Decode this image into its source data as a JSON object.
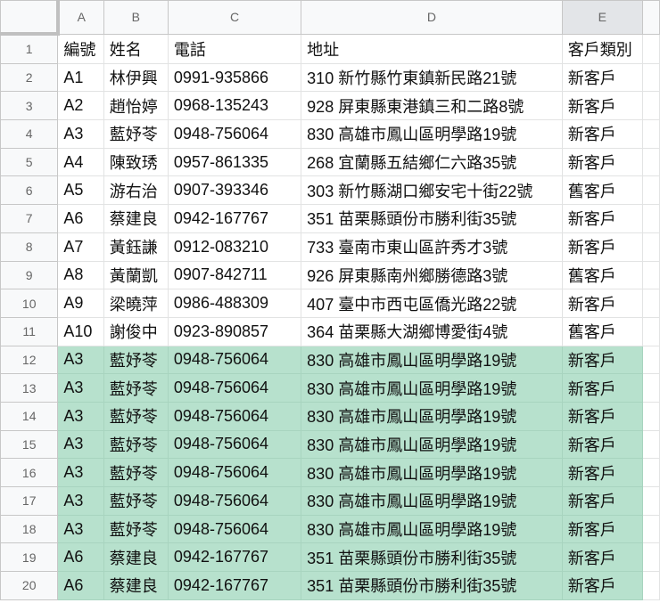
{
  "columns": [
    "A",
    "B",
    "C",
    "D",
    "E"
  ],
  "rows": [
    [
      "編號",
      "姓名",
      "電話",
      "地址",
      "客戶類別"
    ],
    [
      "A1",
      "林伊興",
      "0991-935866",
      "310 新竹縣竹東鎮新民路21號",
      "新客戶"
    ],
    [
      "A2",
      "趙怡婷",
      "0968-135243",
      "928 屏東縣東港鎮三和二路8號",
      "新客戶"
    ],
    [
      "A3",
      "藍妤苓",
      "0948-756064",
      "830 高雄市鳳山區明學路19號",
      "新客戶"
    ],
    [
      "A4",
      "陳致琇",
      "0957-861335",
      "268 宜蘭縣五結鄉仁六路35號",
      "新客戶"
    ],
    [
      "A5",
      "游右治",
      "0907-393346",
      "303 新竹縣湖口鄉安宅十街22號",
      "舊客戶"
    ],
    [
      "A6",
      "蔡建良",
      "0942-167767",
      "351 苗栗縣頭份市勝利街35號",
      "新客戶"
    ],
    [
      "A7",
      "黃鈺謙",
      "0912-083210",
      "733 臺南市東山區許秀才3號",
      "新客戶"
    ],
    [
      "A8",
      "黃蘭凱",
      "0907-842711",
      "926 屏東縣南州鄉勝德路3號",
      "舊客戶"
    ],
    [
      "A9",
      "梁曉萍",
      "0986-488309",
      "407 臺中市西屯區僑光路22號",
      "新客戶"
    ],
    [
      "A10",
      "謝俊中",
      "0923-890857",
      "364 苗栗縣大湖鄉博愛街4號",
      "舊客戶"
    ],
    [
      "A3",
      "藍妤苓",
      "0948-756064",
      "830 高雄市鳳山區明學路19號",
      "新客戶"
    ],
    [
      "A3",
      "藍妤苓",
      "0948-756064",
      "830 高雄市鳳山區明學路19號",
      "新客戶"
    ],
    [
      "A3",
      "藍妤苓",
      "0948-756064",
      "830 高雄市鳳山區明學路19號",
      "新客戶"
    ],
    [
      "A3",
      "藍妤苓",
      "0948-756064",
      "830 高雄市鳳山區明學路19號",
      "新客戶"
    ],
    [
      "A3",
      "藍妤苓",
      "0948-756064",
      "830 高雄市鳳山區明學路19號",
      "新客戶"
    ],
    [
      "A3",
      "藍妤苓",
      "0948-756064",
      "830 高雄市鳳山區明學路19號",
      "新客戶"
    ],
    [
      "A3",
      "藍妤苓",
      "0948-756064",
      "830 高雄市鳳山區明學路19號",
      "新客戶"
    ],
    [
      "A6",
      "蔡建良",
      "0942-167767",
      "351 苗栗縣頭份市勝利街35號",
      "新客戶"
    ],
    [
      "A6",
      "蔡建良",
      "0942-167767",
      "351 苗栗縣頭份市勝利街35號",
      "新客戶"
    ]
  ],
  "row_numbers": [
    "1",
    "2",
    "3",
    "4",
    "5",
    "6",
    "7",
    "8",
    "9",
    "10",
    "11",
    "12",
    "13",
    "14",
    "15",
    "16",
    "17",
    "18",
    "19",
    "20"
  ],
  "highlighted_rows_from": 12,
  "highlight_color": "#b7e1cd",
  "selected_column": "E"
}
